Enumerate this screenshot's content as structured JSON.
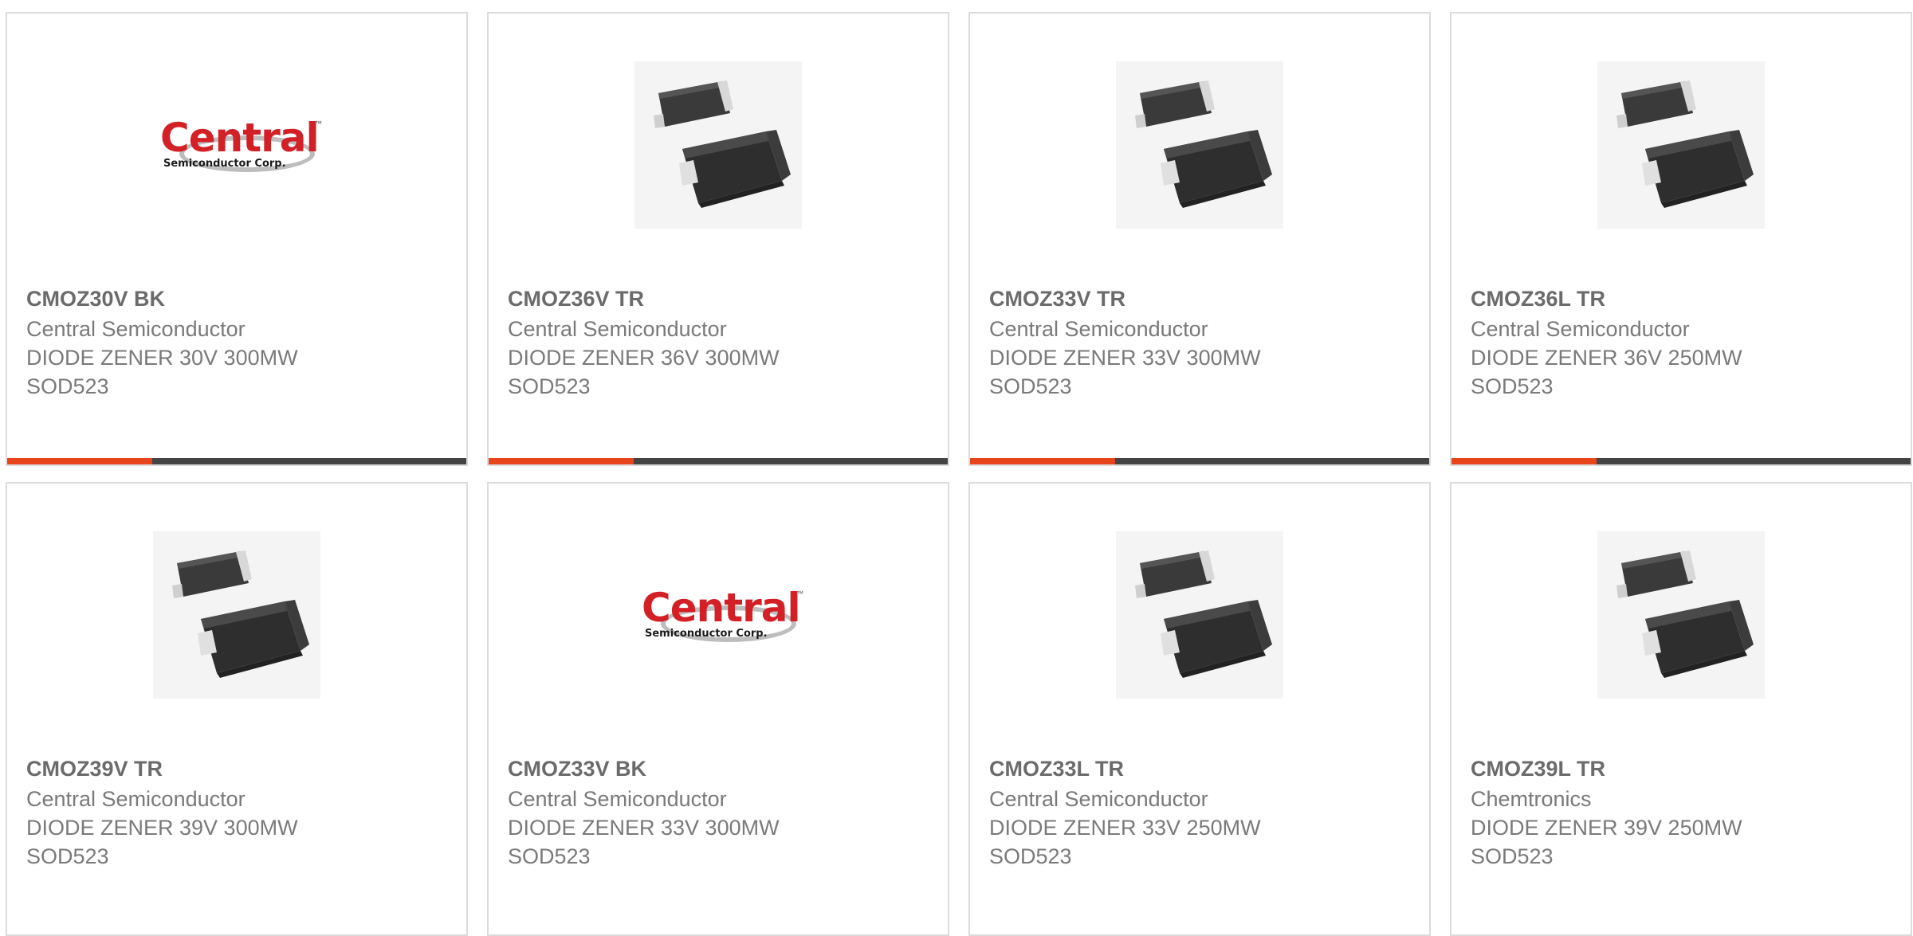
{
  "products": [
    {
      "part": "CMOZ30V BK",
      "maker": "Central Semiconductor",
      "desc": "DIODE ZENER 30V 300MW",
      "pkg": "SOD523",
      "image": "central-logo"
    },
    {
      "part": "CMOZ36V TR",
      "maker": "Central Semiconductor",
      "desc": "DIODE ZENER 36V 300MW",
      "pkg": "SOD523",
      "image": "sod523-package"
    },
    {
      "part": "CMOZ33V TR",
      "maker": "Central Semiconductor",
      "desc": "DIODE ZENER 33V 300MW",
      "pkg": "SOD523",
      "image": "sod523-package"
    },
    {
      "part": "CMOZ36L TR",
      "maker": "Central Semiconductor",
      "desc": "DIODE ZENER 36V 250MW",
      "pkg": "SOD523",
      "image": "sod523-package"
    },
    {
      "part": "CMOZ39V TR",
      "maker": "Central Semiconductor",
      "desc": "DIODE ZENER 39V 300MW",
      "pkg": "SOD523",
      "image": "sod523-package"
    },
    {
      "part": "CMOZ33V BK",
      "maker": "Central Semiconductor",
      "desc": "DIODE ZENER 33V 300MW",
      "pkg": "SOD523",
      "image": "central-logo"
    },
    {
      "part": "CMOZ33L TR",
      "maker": "Central Semiconductor",
      "desc": "DIODE ZENER 33V 250MW",
      "pkg": "SOD523",
      "image": "sod523-package"
    },
    {
      "part": "CMOZ39L TR",
      "maker": "Chemtronics",
      "desc": "DIODE ZENER 39V 250MW",
      "pkg": "SOD523",
      "image": "sod523-package"
    }
  ],
  "logo": {
    "word": "Central",
    "sub": "Semiconductor Corp.",
    "tm": "™"
  },
  "colors": {
    "accent": "#e8451d",
    "bar": "#444444",
    "logo_red": "#d22026",
    "text": "#7a7a7a"
  }
}
